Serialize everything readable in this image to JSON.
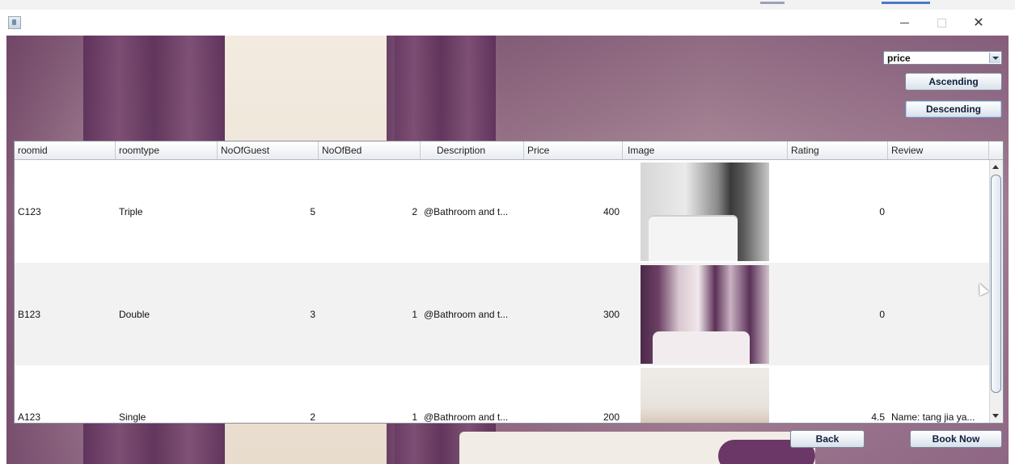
{
  "window": {
    "title": "",
    "icons": {
      "app": "java-app-icon",
      "minimize": "minimize-icon",
      "maximize": "maximize-icon",
      "close": "close-icon"
    }
  },
  "sort": {
    "selected": "price",
    "ascending_label": "Ascending",
    "descending_label": "Descending"
  },
  "table": {
    "columns": [
      "roomid",
      "roomtype",
      "NoOfGuest",
      "NoOfBed",
      "Description",
      "Price",
      "Image",
      "Rating",
      "Review"
    ],
    "rows": [
      {
        "roomid": "C123",
        "roomtype": "Triple",
        "guests": "5",
        "beds": "2",
        "description": "@Bathroom and t...",
        "price": "400",
        "image": "room-photo-white-bedroom",
        "rating": "0",
        "review": ""
      },
      {
        "roomid": "B123",
        "roomtype": "Double",
        "guests": "3",
        "beds": "1",
        "description": "@Bathroom and t...",
        "price": "300",
        "image": "room-photo-purple-bedroom",
        "rating": "0",
        "review": ""
      },
      {
        "roomid": "A123",
        "roomtype": "Single",
        "guests": "2",
        "beds": "1",
        "description": "@Bathroom and t...",
        "price": "200",
        "image": "room-photo-single-bedroom",
        "rating": "4.5",
        "review": "Name: tang jia ya..."
      }
    ]
  },
  "footer": {
    "back_label": "Back",
    "book_label": "Book Now"
  },
  "colors": {
    "curtain": "#5a2e58",
    "button_text": "#0e1e3a",
    "alt_row": "#f2f2f2"
  }
}
